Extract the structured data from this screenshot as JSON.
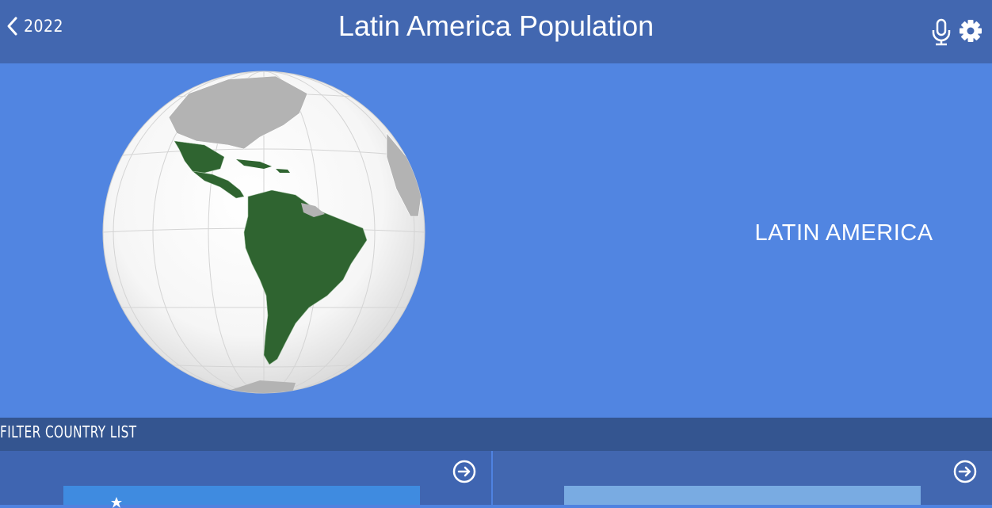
{
  "header": {
    "back_label": "2022",
    "title": "Latin America Population",
    "mic_icon": "microphone-icon",
    "settings_icon": "gear-icon"
  },
  "hero": {
    "region_label": "LATIN AMERICA"
  },
  "filter": {
    "label": "FILTER COUNTRY LIST"
  },
  "colors": {
    "header_bg": "#4267b0",
    "hero_bg": "#5185e1",
    "filter_bg": "#345590",
    "highlight_land": "#2f6430",
    "other_land": "#b3b3b3",
    "tile_left": "#3f8be0",
    "tile_right": "#79abe2"
  }
}
